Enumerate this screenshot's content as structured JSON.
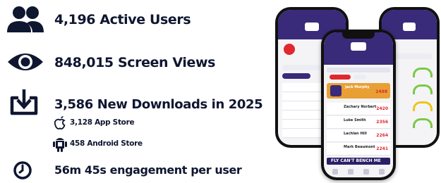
{
  "stats": {
    "active_users": "4,196 Active Users",
    "screen_views": "848,015 Screen Views",
    "downloads": "3,586 New Downloads in 2025",
    "app_store": "3,128 App Store",
    "android_store": "458 Android Store",
    "engagement": "56m 45s engagement per user"
  },
  "icons": {
    "users": "users-icon",
    "views": "eye-icon",
    "downloads": "download-icon",
    "apple": "apple-icon",
    "android": "android-icon",
    "engagement": "clock-icon"
  },
  "phones": {
    "center": {
      "banner_name": "Jack Murphy",
      "banner_score": "2498",
      "entries": [
        {
          "name": "Zachary Norbert",
          "score": "2420"
        },
        {
          "name": "Luke Smith",
          "score": "2356"
        },
        {
          "name": "Lachlan Hill",
          "score": "2264"
        },
        {
          "name": "Mark Beaumont",
          "score": "2241"
        }
      ],
      "promo": "FLY CAN'T BENCH ME"
    }
  },
  "colors": {
    "text": "#0f1630",
    "app_header": "#3a2a7a",
    "score_red": "#e0282d",
    "gauge_green": "#7ac943",
    "gauge_yellow": "#f0c419"
  }
}
